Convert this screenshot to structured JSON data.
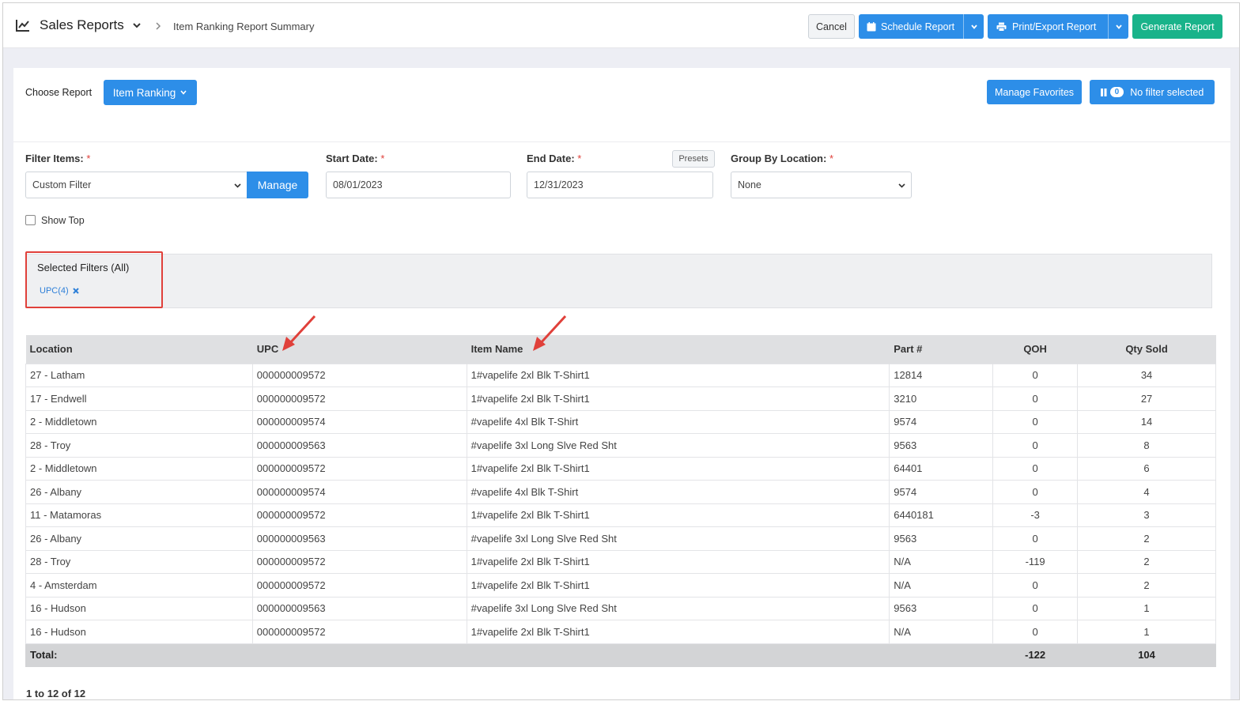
{
  "header": {
    "title": "Sales Reports",
    "breadcrumb": "Item Ranking Report Summary",
    "cancel_label": "Cancel",
    "schedule_label": "Schedule Report",
    "print_label": "Print/Export Report",
    "generate_label": "Generate Report"
  },
  "report": {
    "choose_label": "Choose Report",
    "selected_report": "Item Ranking",
    "manage_favorites_label": "Manage Favorites",
    "filter_count": "0",
    "filter_status": "No filter selected"
  },
  "form": {
    "filter_items_label": "Filter Items:",
    "filter_items_value": "Custom Filter",
    "manage_label": "Manage",
    "start_date_label": "Start Date:",
    "start_date_value": "08/01/2023",
    "end_date_label": "End Date:",
    "end_date_value": "12/31/2023",
    "presets_label": "Presets",
    "group_by_label": "Group By Location:",
    "group_by_value": "None",
    "show_top_label": "Show Top",
    "required_mark": "*"
  },
  "filters": {
    "title": "Selected Filters (All)",
    "chip": "UPC(4)"
  },
  "table": {
    "columns": [
      "Location",
      "UPC",
      "Item Name",
      "Part #",
      "QOH",
      "Qty Sold"
    ],
    "rows": [
      [
        "27 - Latham",
        "000000009572",
        "1#vapelife 2xl Blk T-Shirt1",
        "12814",
        "0",
        "34"
      ],
      [
        "17 - Endwell",
        "000000009572",
        "1#vapelife 2xl Blk T-Shirt1",
        "3210",
        "0",
        "27"
      ],
      [
        "2 - Middletown",
        "000000009574",
        "#vapelife 4xl Blk T-Shirt",
        "9574",
        "0",
        "14"
      ],
      [
        "28 - Troy",
        "000000009563",
        "#vapelife 3xl Long Slve Red Sht",
        "9563",
        "0",
        "8"
      ],
      [
        "2 - Middletown",
        "000000009572",
        "1#vapelife 2xl Blk T-Shirt1",
        "64401",
        "0",
        "6"
      ],
      [
        "26 - Albany",
        "000000009574",
        "#vapelife 4xl Blk T-Shirt",
        "9574",
        "0",
        "4"
      ],
      [
        "11 - Matamoras",
        "000000009572",
        "1#vapelife 2xl Blk T-Shirt1",
        "6440181",
        "-3",
        "3"
      ],
      [
        "26 - Albany",
        "000000009563",
        "#vapelife 3xl Long Slve Red Sht",
        "9563",
        "0",
        "2"
      ],
      [
        "28 - Troy",
        "000000009572",
        "1#vapelife 2xl Blk T-Shirt1",
        "N/A",
        "-119",
        "2"
      ],
      [
        "4 - Amsterdam",
        "000000009572",
        "1#vapelife 2xl Blk T-Shirt1",
        "N/A",
        "0",
        "2"
      ],
      [
        "16 - Hudson",
        "000000009563",
        "#vapelife 3xl Long Slve Red Sht",
        "9563",
        "0",
        "1"
      ],
      [
        "16 - Hudson",
        "000000009572",
        "1#vapelife 2xl Blk T-Shirt1",
        "N/A",
        "0",
        "1"
      ]
    ],
    "total_label": "Total:",
    "total_qoh": "-122",
    "total_qty_sold": "104"
  },
  "pager": {
    "text": "1 to 12 of 12"
  },
  "colors": {
    "primary": "#2d8ee8",
    "success": "#19b38a",
    "annotation": "#e0403a"
  }
}
